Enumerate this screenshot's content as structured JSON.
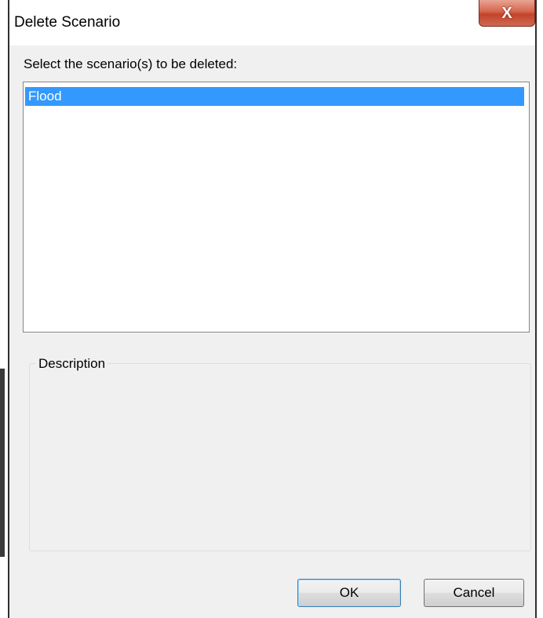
{
  "window": {
    "title": "Delete Scenario",
    "close_glyph": "X"
  },
  "prompt": "Select the scenario(s) to be deleted:",
  "scenarios": [
    {
      "label": "Flood",
      "selected": true
    }
  ],
  "description": {
    "legend": "Description",
    "text": ""
  },
  "buttons": {
    "ok": "OK",
    "cancel": "Cancel"
  },
  "colors": {
    "selection": "#3399ff",
    "close_button": "#c7503a",
    "dialog_face": "#f0f0f0"
  }
}
